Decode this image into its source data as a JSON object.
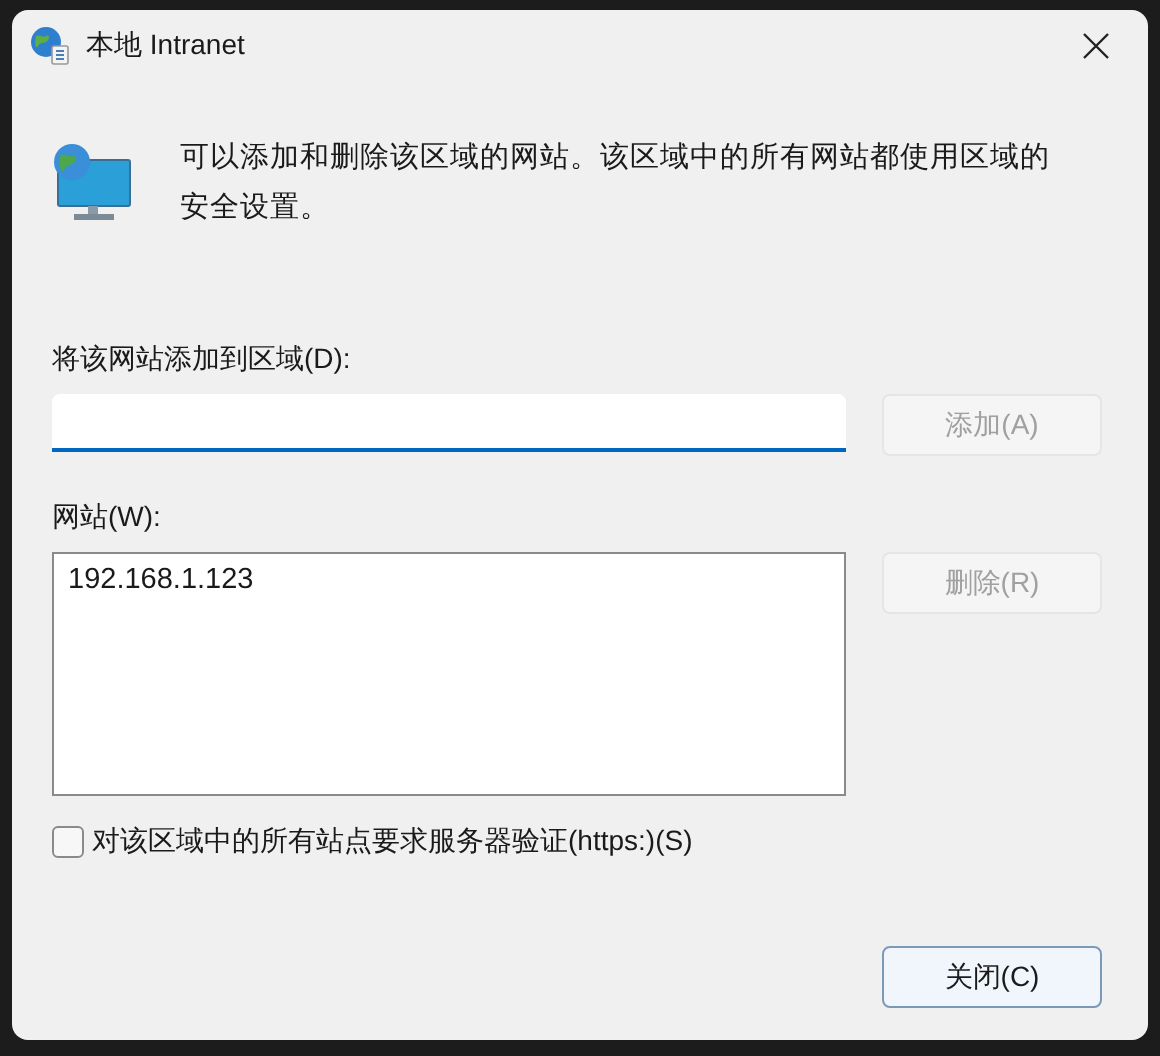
{
  "window": {
    "title": "本地 Intranet"
  },
  "description": "可以添加和删除该区域的网站。该区域中的所有网站都使用区域的安全设置。",
  "add_field": {
    "label": "将该网站添加到区域(D):",
    "focused": true
  },
  "add_button": {
    "label": "添加(A)",
    "disabled": true
  },
  "sites": {
    "label": "网站(W):",
    "items": [
      {
        "text": "192.168.1.123",
        "selected": false
      }
    ]
  },
  "remove_button": {
    "label": "删除(R)",
    "disabled": true
  },
  "https_checkbox": {
    "label": "对该区域中的所有站点要求服务器验证(https:)(S)",
    "checked": false
  },
  "close_button": {
    "label": "关闭(C)",
    "disabled": false
  }
}
